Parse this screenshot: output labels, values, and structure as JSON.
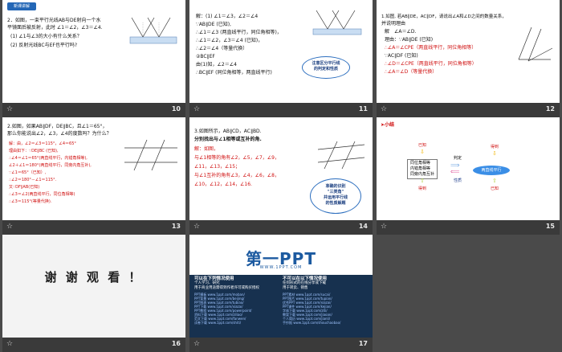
{
  "slides": [
    {
      "number": "10",
      "tag": "新课讲解",
      "lines": [
        "2．如图，一束平行光线AB与DE射向一个水",
        "平镜面后被反射，此时 ∠1＝∠2，∠3＝∠4.",
        "(1) ∠1与∠3的大小有什么关系？",
        "(2) 反射光线BC与EF也平行吗?"
      ]
    },
    {
      "number": "11",
      "lines": [
        "解：(1) ∠1＝∠3，∠2＝∠4",
        "∵AB∥DE (已知),",
        "∴∠1＝∠3 (两直线平行，同位角相等)，",
        "∴∠1＝∠2，∠3＝∠4 (已知)，",
        "∴∠2＝∠4（等量代换）",
        "②BC∥EF",
        "由(1)知，∠2＝∠4",
        "∴BC∥EF (同位角相等，两直线平行)"
      ],
      "bubble": [
        "注意区分平行线",
        "的判定和性质"
      ]
    },
    {
      "number": "12",
      "lines": [
        "1.如图, 若AB∥DE，AC∥DF，请说出∠A和∠D之间的数量关系，",
        "并说明理由",
        "解　∠A＝∠D.",
        "理由：∵AB∥DE (已知)",
        "∴∠A＝∠CPE（两直线平行，同位角相等）",
        "∵AC∥DF (已知)",
        "∴∠D＝∠CPE（两直线平行，同位角相等）",
        "∴∠A＝∠D（等量代换）"
      ]
    },
    {
      "number": "13",
      "lines": [
        "2.如图，如果AB∥DF，DE∥BC，且∠1＝65°，",
        "那么你能说出∠2，∠3，∠4的度数吗？为什么？",
        "解：由，∠2＝∠3＝115°，∠4＝65°",
        "理由如下：∵DE∥BC (已知),",
        "∴∠4＝∠1＝65°(两直线平行，内错角相等),",
        "∠2＋∠1＝180°(两直线平行，同旁内角互补),",
        "∵∠1＝65°（已知）,",
        "∴∠2＝180°－∠1＝115°.",
        "又∵DF∥AB(已知)",
        "∴∠3＝∠2(两直线平行，同位角相等)",
        "∴∠3＝115°(等量代换)."
      ]
    },
    {
      "number": "14",
      "lines": [
        "3.如图所示，AB∥CD，AC∥BD.",
        "分别找出与∠1相等或互补的角.",
        "解：如图，",
        "与∠1相等的角有∠2，∠5，∠7，∠9，",
        "∠11，∠13，∠15；",
        "与∠1互补的角有∠3，∠4，∠6，∠8，",
        "∠10，∠12，∠14，∠16."
      ],
      "bubble": [
        "准确的识别",
        "\"三类角\"",
        "并运用平行线",
        "的性质解题"
      ]
    },
    {
      "number": "15",
      "title": "小结",
      "left_items": [
        "同位角相等",
        "内错角相等",
        "同旁内角互补"
      ],
      "center": "两直线平行",
      "labels": {
        "top_left": "已知",
        "top_right": "得到",
        "bottom_left": "得到",
        "bottom_right": "已知",
        "judge": "判定",
        "property": "性质"
      }
    },
    {
      "number": "16",
      "thanks": "谢 谢 观 看 ！"
    },
    {
      "number": "17",
      "logo": "第一PPT",
      "url": "WWW.1PPT.COM",
      "left_heading": "可以在下列情况使用",
      "left_notes": [
        "个人学习、研究",
        "用于商业用途需得到作者许可或购买授权"
      ],
      "right_heading": "不可以在以下情况使用",
      "right_notes": [
        "任何形式的在线分享或下载",
        "用于转卖、销售"
      ],
      "left_links": [
        "PPT模板 www.1ppt.com/moban/",
        "PPT背景 www.1ppt.com/beijing/",
        "PPT图表 www.1ppt.com/tubiao/",
        "PPT下载 www.1ppt.com/xiazai/",
        "PPT教程 www.1ppt.com/powerpoint/",
        "资料下载 www.1ppt.com/ziliao/",
        "范文下载 www.1ppt.com/fanwen/",
        "试卷下载 www.1ppt.com/shiti/"
      ],
      "right_links": [
        "PPT素材 www.1ppt.com/sucai/",
        "PPT图片 www.1ppt.com/tupian/",
        "优秀PPT www.1ppt.com/xiazai/",
        "PPT课件 www.1ppt.com/kejian/",
        "字体下载 www.1ppt.com/ziti/",
        "教案下载 www.1ppt.com/jiaoan/",
        "个人简历 www.1ppt.com/jianli/",
        "手抄报 www.1ppt.com/shouchaobao/"
      ]
    }
  ],
  "colors": {
    "accent": "#2467b6",
    "red": "#d01010",
    "dark_blue": "#17314f",
    "background": "#4a4a4a"
  }
}
